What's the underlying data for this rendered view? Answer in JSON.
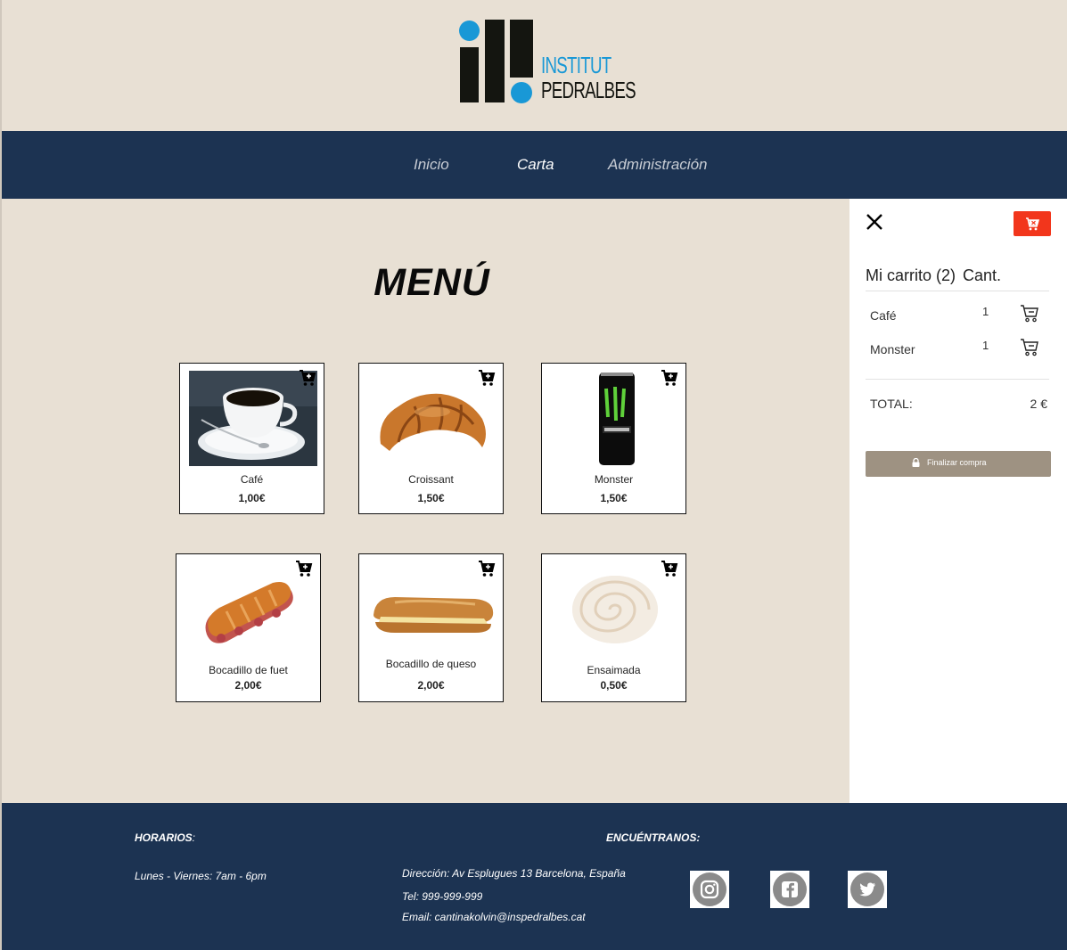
{
  "logo": {
    "line1": "INSTITUT",
    "line2": "PEDRALBES"
  },
  "nav": {
    "items": [
      {
        "label": "Inicio",
        "active": false
      },
      {
        "label": "Carta",
        "active": true
      },
      {
        "label": "Administración",
        "active": false
      }
    ]
  },
  "main": {
    "title": "MENÚ"
  },
  "products": [
    {
      "name": "Café",
      "price": "1,00€",
      "icon": "coffee-cup-photo"
    },
    {
      "name": "Croissant",
      "price": "1,50€",
      "icon": "croissant-photo"
    },
    {
      "name": "Monster",
      "price": "1,50€",
      "icon": "monster-can-photo"
    },
    {
      "name": "Bocadillo de fuet",
      "price": "2,00€",
      "icon": "fuet-sandwich-photo"
    },
    {
      "name": "Bocadillo de queso",
      "price": "2,00€",
      "icon": "cheese-sandwich-photo"
    },
    {
      "name": "Ensaimada",
      "price": "0,50€",
      "icon": "ensaimada-photo"
    }
  ],
  "cart": {
    "title": "Mi carrito (2)",
    "qty_header": "Cant.",
    "items": [
      {
        "name": "Café",
        "qty": "1"
      },
      {
        "name": "Monster",
        "qty": "1"
      }
    ],
    "total_label": "TOTAL:",
    "total_value": "2 €",
    "checkout_label": "Finalizar compra",
    "accent_color": "#f2361c",
    "checkout_color": "#9e9282"
  },
  "footer": {
    "hours_title": "HORARIOS",
    "hours_text": "Lunes - Viernes: 7am - 6pm",
    "find_title": "ENCUÉNTRANOS:",
    "address": "Dirección: Av Esplugues 13 Barcelona, España",
    "phone": "Tel: 999-999-999",
    "email": "Email: cantinakolvin@inspedralbes.cat",
    "social": [
      "instagram-icon",
      "facebook-icon",
      "twitter-icon"
    ]
  },
  "colors": {
    "background": "#e8e0d4",
    "navy": "#1c3352",
    "logo_blue": "#1998d6"
  }
}
